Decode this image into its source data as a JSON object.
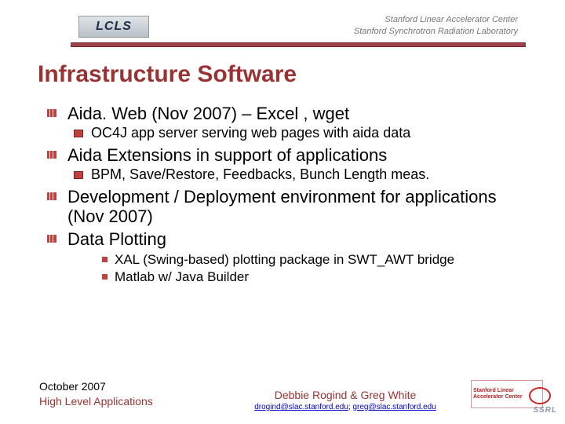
{
  "header": {
    "lcls": "LCLS",
    "org1": "Stanford Linear Accelerator Center",
    "org2": "Stanford Synchrotron Radiation Laboratory"
  },
  "title": "Infrastructure Software",
  "bullets": {
    "b1": "Aida. Web (Nov 2007) – Excel , wget",
    "b1a": "OC4J app server serving web pages with aida data",
    "b2": "Aida Extensions in support of applications",
    "b2a": "BPM, Save/Restore, Feedbacks, Bunch Length meas.",
    "b3": "Development / Deployment environment for applications (Nov 2007)",
    "b4": "Data Plotting",
    "b4a": "XAL (Swing-based) plotting package in SWT_AWT bridge",
    "b4b": "Matlab w/ Java Builder"
  },
  "footer": {
    "date": "October  2007",
    "subtitle": "High Level Applications",
    "authors": "Debbie Rogind & Greg White",
    "email1": "drogind@slac.stanford.edu",
    "email_sep": "; ",
    "email2": "greg@slac.stanford.edu",
    "logo_text": "Stanford Linear Accelerator Center",
    "badge": "SSRL"
  }
}
